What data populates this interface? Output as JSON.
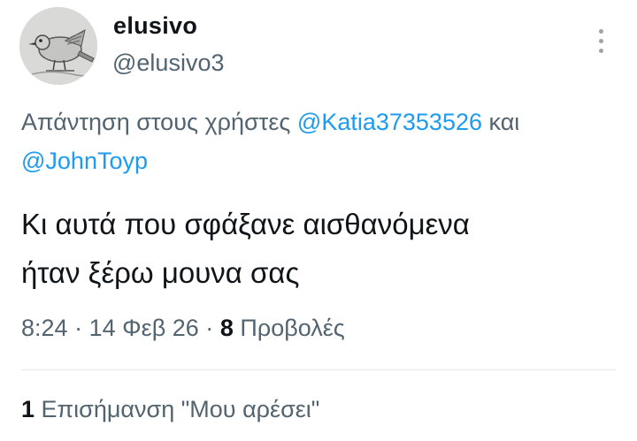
{
  "author": {
    "display_name": "elusivo",
    "handle": "@elusivo3"
  },
  "reply_context": {
    "prefix": "Απάντηση στους χρήστες",
    "mention_1": "@Katia37353526",
    "conjunction": "και",
    "mention_2": "@JohnToyp"
  },
  "tweet": {
    "text_line_1": "Κι αυτά που σφάξανε αισθανόμενα",
    "text_line_2": "ήταν ξέρω μουνα σας"
  },
  "meta": {
    "time": "8:24",
    "separator": "·",
    "date": "14 Φεβ 26",
    "views_count": "8",
    "views_label": "Προβολές"
  },
  "engagement": {
    "likes_count": "1",
    "likes_label": "Επισήμανση \"Μου αρέσει\""
  },
  "icons": {
    "more": "more-vertical-icon",
    "avatar": "bird-sketch-avatar"
  },
  "colors": {
    "primary_text": "#0f1419",
    "secondary_text": "#536471",
    "link": "#1d9bf0",
    "divider": "#e6e9ec"
  }
}
